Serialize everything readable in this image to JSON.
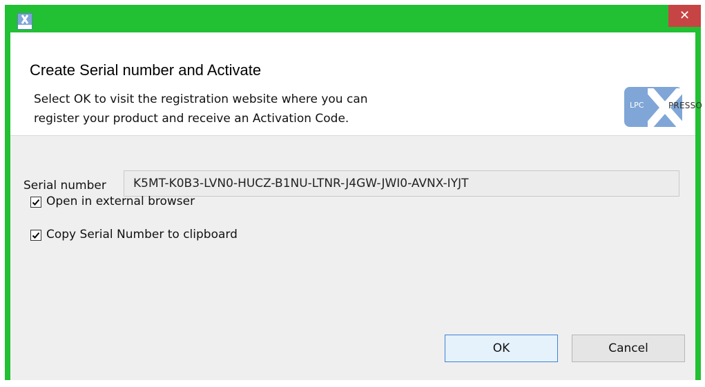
{
  "window": {
    "close_glyph": "✕",
    "icon": "lpcxpresso-app-icon"
  },
  "header": {
    "title": "Create Serial number and Activate",
    "message_line1": "Select OK to visit the registration website where you can",
    "message_line2": "register your product and receive an Activation Code.",
    "logo": {
      "left_text": "LPC",
      "right_text": "PRESSO"
    }
  },
  "serial": {
    "label": "Serial number",
    "value": "K5MT-K0B3-LVN0-HUCZ-B1NU-LTNR-J4GW-JWI0-AVNX-IYJT"
  },
  "options": {
    "open_browser": {
      "label": "Open in external browser",
      "checked": true
    },
    "copy_clipboard": {
      "label": "Copy Serial Number to clipboard",
      "checked": true
    }
  },
  "buttons": {
    "ok": "OK",
    "cancel": "Cancel"
  },
  "colors": {
    "frame": "#22c033",
    "close": "#c74444",
    "ok_border": "#3c82d6",
    "logo": "#7fa6d6"
  }
}
